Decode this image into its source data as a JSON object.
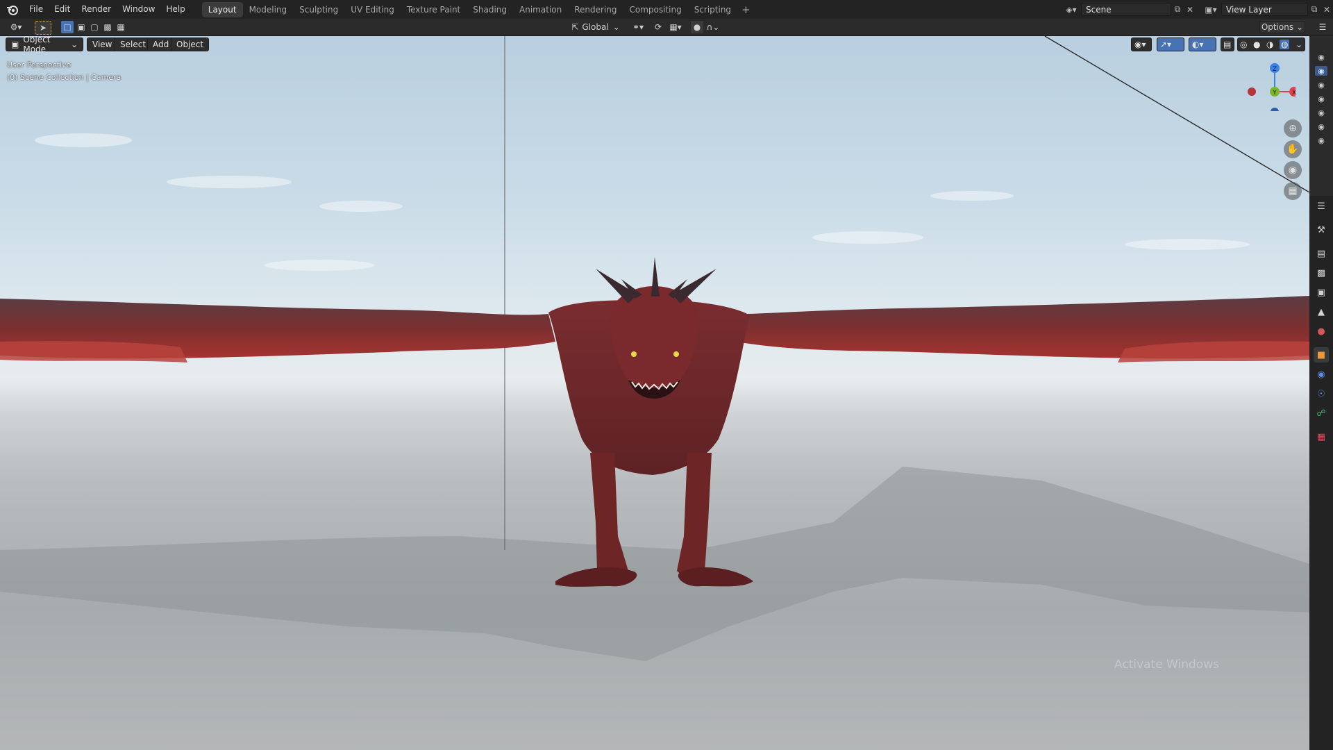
{
  "menu": [
    "File",
    "Edit",
    "Render",
    "Window",
    "Help"
  ],
  "workspaces": [
    "Layout",
    "Modeling",
    "Sculpting",
    "UV Editing",
    "Texture Paint",
    "Shading",
    "Animation",
    "Rendering",
    "Compositing",
    "Scripting"
  ],
  "workspace_active": "Layout",
  "workspace_add": "+",
  "scene": {
    "label": "Scene"
  },
  "view_layer": {
    "label": "View Layer"
  },
  "transform": {
    "orientation": "Global"
  },
  "options_label": "Options",
  "viewport": {
    "mode": "Object Mode",
    "view": "View",
    "select": "Select",
    "add": "Add",
    "object": "Object",
    "info_line1": "User Perspective",
    "info_line2": "(0) Scene Collection | Camera"
  },
  "gizmo": {
    "z": "Z",
    "y": "Y",
    "x": "X"
  },
  "watermark": "Activate Windows",
  "colors": {
    "accent_active": "#4772b3",
    "axis_x": "#e0414f",
    "axis_y": "#7bb52c",
    "axis_z": "#3b82e8",
    "dragon_red": "#8e2f2e"
  },
  "icons": {
    "left_tools": [
      "editor-type-icon",
      "select-cursor-icon",
      "select-box-icon",
      "select-extend-icon",
      "select-subtract-icon",
      "select-difference-icon",
      "select-intersect-icon"
    ],
    "right_nav": [
      "zoom-icon",
      "hand-pan-icon",
      "camera-view-icon",
      "grid-ortho-icon"
    ]
  }
}
